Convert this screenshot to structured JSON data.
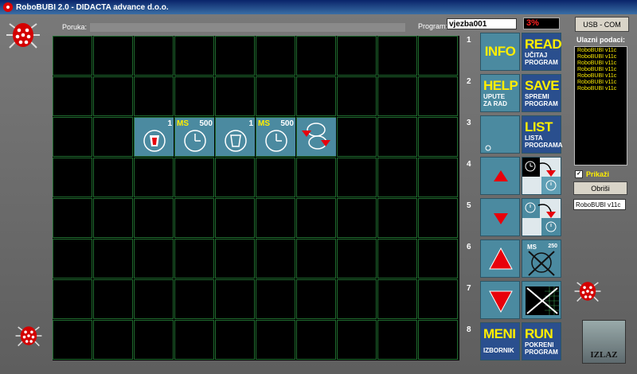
{
  "window": {
    "title": "RoboBUBI 2.0 - DIDACTA advance d.o.o."
  },
  "header": {
    "poruka_label": "Poruka:",
    "program_label": "Program:",
    "program_value": "vjezba001",
    "progress_text": "3%",
    "usb_label": "USB - COM"
  },
  "grid": {
    "rows": 8,
    "cols": 10
  },
  "program_cells": [
    {
      "col": 2,
      "row": 2,
      "icon": "light-on-icon",
      "top_right": "1",
      "ms": ""
    },
    {
      "col": 3,
      "row": 2,
      "icon": "clock-icon",
      "top_right": "500",
      "ms": "MS"
    },
    {
      "col": 4,
      "row": 2,
      "icon": "light-off-icon",
      "top_right": "1",
      "ms": ""
    },
    {
      "col": 5,
      "row": 2,
      "icon": "clock-icon",
      "top_right": "500",
      "ms": "MS"
    },
    {
      "col": 6,
      "row": 2,
      "icon": "loop-icon",
      "top_right": "",
      "ms": ""
    }
  ],
  "row_numbers": [
    "1",
    "2",
    "3",
    "4",
    "5",
    "6",
    "7",
    "8"
  ],
  "buttons": {
    "info": "INFO",
    "help": "HELP",
    "help_sub1": "UPUTE",
    "help_sub2": "ZA RAD",
    "read": "READ",
    "read_sub1": "UČITAJ",
    "read_sub2": "PROGRAM",
    "save": "SAVE",
    "save_sub1": "SPREMI",
    "save_sub2": "PROGRAM",
    "list": "LIST",
    "list_sub1": "LISTA",
    "list_sub2": "PROGRAMA",
    "meni": "MENI",
    "meni_sub": "IZBORNIK",
    "run": "RUN",
    "run_sub1": "POKRENI",
    "run_sub2": "PROGRAM",
    "ms_small": "MS",
    "ms_value": "250"
  },
  "right_panel": {
    "ulazni_label": "Ulazni podaci:",
    "items": [
      "RoboBUBI v11c",
      "RoboBUBI v11c",
      "RoboBUBI v11c",
      "RoboBUBI v11c",
      "RoboBUBI v11c",
      "RoboBUBI v11c",
      "RoboBUBI v11c"
    ],
    "prikazi_label": "Prikaži",
    "obrisi_label": "Obriši",
    "status_value": "RoboBUBI v11c",
    "izlaz_label": "IZLAZ"
  },
  "colors": {
    "tile": "#4b8aa0",
    "tile_dark": "#2a4f8e",
    "accent_text": "#ffee00",
    "arrow_red": "#e8000b",
    "grid_line": "#1f6b2e"
  }
}
